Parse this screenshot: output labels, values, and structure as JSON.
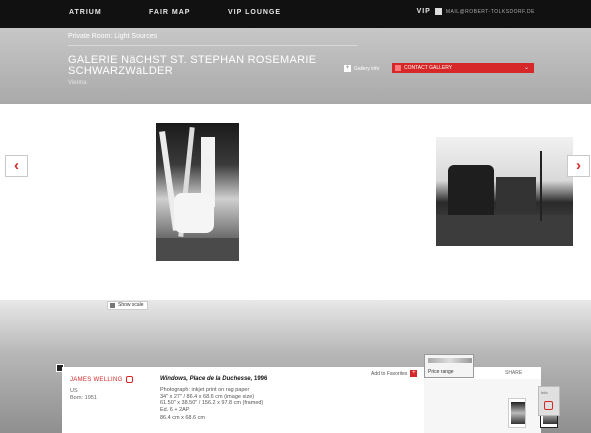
{
  "nav": {
    "items": [
      "ATRIUM",
      "FAIR MAP",
      "VIP LOUNGE"
    ],
    "vip_label": "VIP",
    "email": "MAIL@ROBERT-TOLKSDORF.DE"
  },
  "header": {
    "breadcrumb": "Private Room: Light Sources",
    "gallery_title": "GALERIE NäCHST ST. STEPHAN ROSEMARIE SCHWARZWäLDER",
    "city": "Vienna",
    "gallery_info_label": "Gallery info",
    "contact_label": "CONTACT GALLERY"
  },
  "viewer": {
    "prev_arrow": "‹",
    "next_arrow": "›",
    "show_scale_label": "Show scale"
  },
  "artwork": {
    "artist": "JAMES WELLING",
    "origin": "US",
    "born": "Born: 1951",
    "title": "Windows, Place de la Duchesse,",
    "year": "1996",
    "details": [
      "Photograph: inkjet print on rag paper",
      "34\" x 27\" / 86.4 x 68.6 cm (image size)",
      "61.50\" x 38.50\" / 156.2 x 97.8 cm (framed)",
      "Ed. 6 + 2AP",
      "86.4 cm x 68.6 cm"
    ],
    "favorites_label": "Add to Favorites",
    "price_label": "Price range",
    "share_label": "SHARE",
    "info_label": "Info"
  },
  "colors": {
    "accent": "#d62828",
    "nav_bg": "#111111"
  }
}
